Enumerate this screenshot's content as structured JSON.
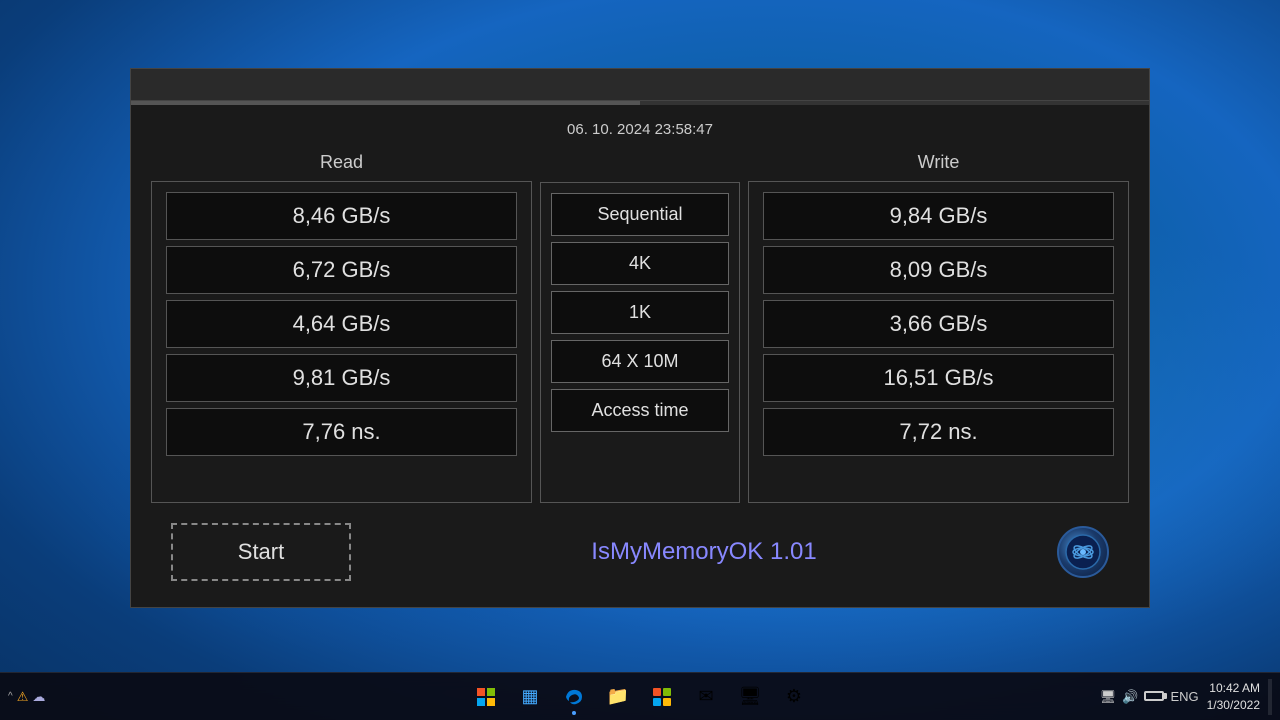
{
  "window": {
    "title": "IsMyMemoryOK",
    "timestamp": "06. 10. 2024 23:58:47",
    "read_header": "Read",
    "write_header": "Write",
    "rows": [
      {
        "label": "Sequential",
        "read": "8,46 GB/s",
        "write": "9,84 GB/s"
      },
      {
        "label": "4K",
        "read": "6,72 GB/s",
        "write": "8,09 GB/s"
      },
      {
        "label": "1K",
        "read": "4,64 GB/s",
        "write": "3,66 GB/s"
      },
      {
        "label": "64 X 10M",
        "read": "9,81 GB/s",
        "write": "16,51 GB/s"
      },
      {
        "label": "Access time",
        "read": "7,76 ns.",
        "write": "7,72 ns."
      }
    ],
    "start_button": "Start",
    "app_title": "IsMyMemoryOK 1.01"
  },
  "taskbar": {
    "start_label": "⊞",
    "time": "10:42 AM",
    "date": "1/30/2022",
    "lang": "ENG",
    "icons": [
      "⊞",
      "▦",
      "◉",
      "📁",
      "⊞",
      "✉",
      "🖥",
      "⚙"
    ]
  }
}
